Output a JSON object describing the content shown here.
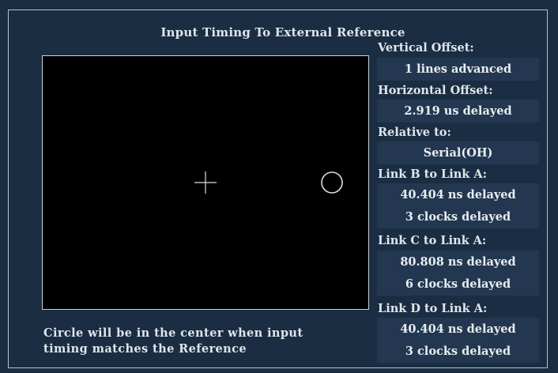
{
  "screen": {
    "title": "Input Timing To External Reference"
  },
  "timing_display": {
    "crosshair_icon": "crosshair-icon",
    "circle_icon": "circle-icon",
    "marker_color": "#d8dde2"
  },
  "readouts": {
    "vertical_offset": {
      "label": "Vertical Offset:",
      "value": "1 lines advanced"
    },
    "horizontal_offset": {
      "label": "Horizontal Offset:",
      "value": "2.919 us delayed"
    },
    "relative_to": {
      "label": "Relative to:",
      "value": "Serial(OH)"
    },
    "link_b": {
      "label": "Link B to Link A:",
      "delay": "40.404 ns delayed",
      "clocks": "3 clocks delayed"
    },
    "link_c": {
      "label": "Link C to Link A:",
      "delay": "80.808 ns delayed",
      "clocks": "6 clocks delayed"
    },
    "link_d": {
      "label": "Link D to Link A:",
      "delay": "40.404 ns delayed",
      "clocks": "3 clocks delayed"
    }
  },
  "footer": {
    "line1": "Circle will be in the center when input",
    "line2": "timing matches the Reference"
  },
  "colors": {
    "background": "#1a2d42",
    "readout_box": "#233850",
    "text": "#dfe6ec",
    "display": "#000000"
  }
}
